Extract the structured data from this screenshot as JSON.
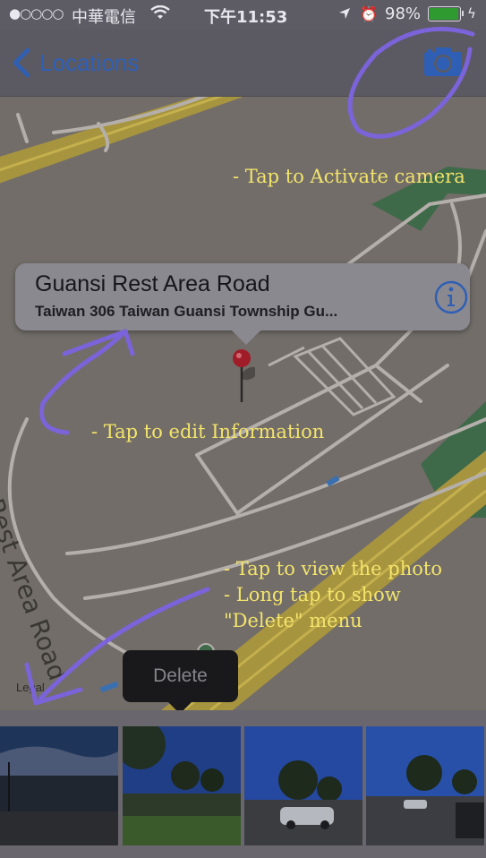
{
  "status_bar": {
    "signal": "●○○○○",
    "carrier": "中華電信",
    "time": "下午11:53",
    "battery_percent": "98%",
    "battery_level": 0.98
  },
  "nav": {
    "back_label": "Locations",
    "back_icon": "chevron-left-icon",
    "camera_icon": "camera-icon"
  },
  "map": {
    "road_label": "Guansi Rest Area Road",
    "legal_label": "Legal"
  },
  "callout": {
    "title": "Guansi Rest Area Road",
    "subtitle": "Taiwan 306 Taiwan Guansi Township Gu...",
    "info_icon": "info-icon"
  },
  "popup": {
    "delete_label": "Delete"
  },
  "annotations": {
    "camera_hint": "- Tap to Activate camera",
    "info_hint": "- Tap to edit Information",
    "photo_hint_1": "- Tap to view the photo",
    "photo_hint_2": "- Long tap to show",
    "photo_hint_3": "\"Delete\" menu"
  },
  "colors": {
    "accent": "#2e5fb5",
    "annotation_text": "#f3e46b",
    "annotation_stroke": "#7b63d9"
  }
}
